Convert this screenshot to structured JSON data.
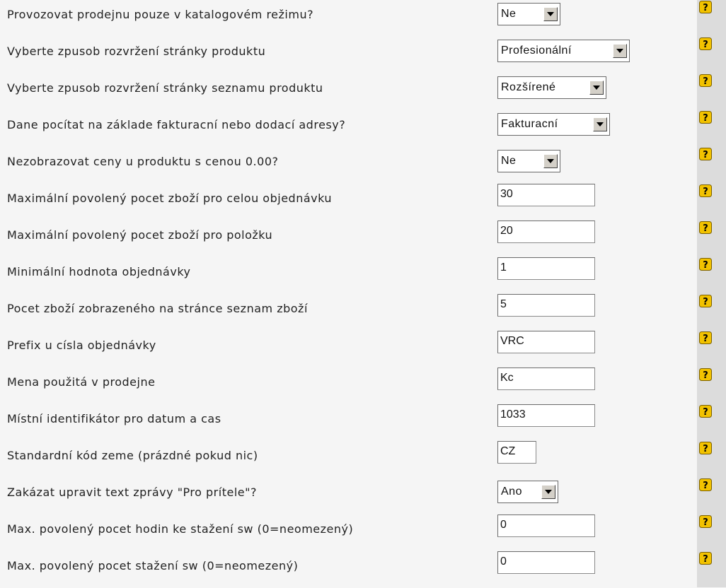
{
  "rows": [
    {
      "label": "Provozovat prodejnu pouze v katalogovém režimu?",
      "type": "select",
      "value": "Ne"
    },
    {
      "label": "Vyberte zpusob rozvržení stránky produktu",
      "type": "select",
      "value": "Profesionální"
    },
    {
      "label": "Vyberte zpusob rozvržení stránky seznamu produktu",
      "type": "select",
      "value": "Rozšírené"
    },
    {
      "label": "Dane pocítat na základe fakturacní nebo dodací adresy?",
      "type": "select",
      "value": "Fakturacní"
    },
    {
      "label": "Nezobrazovat ceny u produktu s cenou 0.00?",
      "type": "select",
      "value": "Ne"
    },
    {
      "label": "Maximální povolený pocet zboží pro celou objednávku",
      "type": "input",
      "value": "30"
    },
    {
      "label": "Maximální povolený pocet zboží pro položku",
      "type": "input",
      "value": "20"
    },
    {
      "label": "Minimální hodnota objednávky",
      "type": "input",
      "value": "1"
    },
    {
      "label": "Pocet zboží zobrazeného na stránce seznam zboží",
      "type": "input",
      "value": "5"
    },
    {
      "label": "Prefix u císla objednávky",
      "type": "input",
      "value": "VRC"
    },
    {
      "label": "Mena použitá v prodejne",
      "type": "input",
      "value": "Kc"
    },
    {
      "label": "Místní identifikátor pro datum a cas",
      "type": "input",
      "value": "1033"
    },
    {
      "label": "Standardní kód zeme (prázdné pokud nic)",
      "type": "input",
      "value": "CZ"
    },
    {
      "label": "Zakázat upravit text zprávy \"Pro prítele\"?",
      "type": "select",
      "value": "Ano"
    },
    {
      "label": "Max. povolený pocet hodin ke stažení sw (0=neomezený)",
      "type": "input",
      "value": "0"
    },
    {
      "label": "Max. povolený pocet stažení sw (0=neomezený)",
      "type": "input",
      "value": "0"
    }
  ],
  "help_icon": {
    "name": "help-icon",
    "glyph": "?",
    "color": "#f2c200",
    "border": "#7a6000"
  },
  "colors": {
    "background": "#f5f5f5",
    "right_strip": "#dcdcdc"
  }
}
